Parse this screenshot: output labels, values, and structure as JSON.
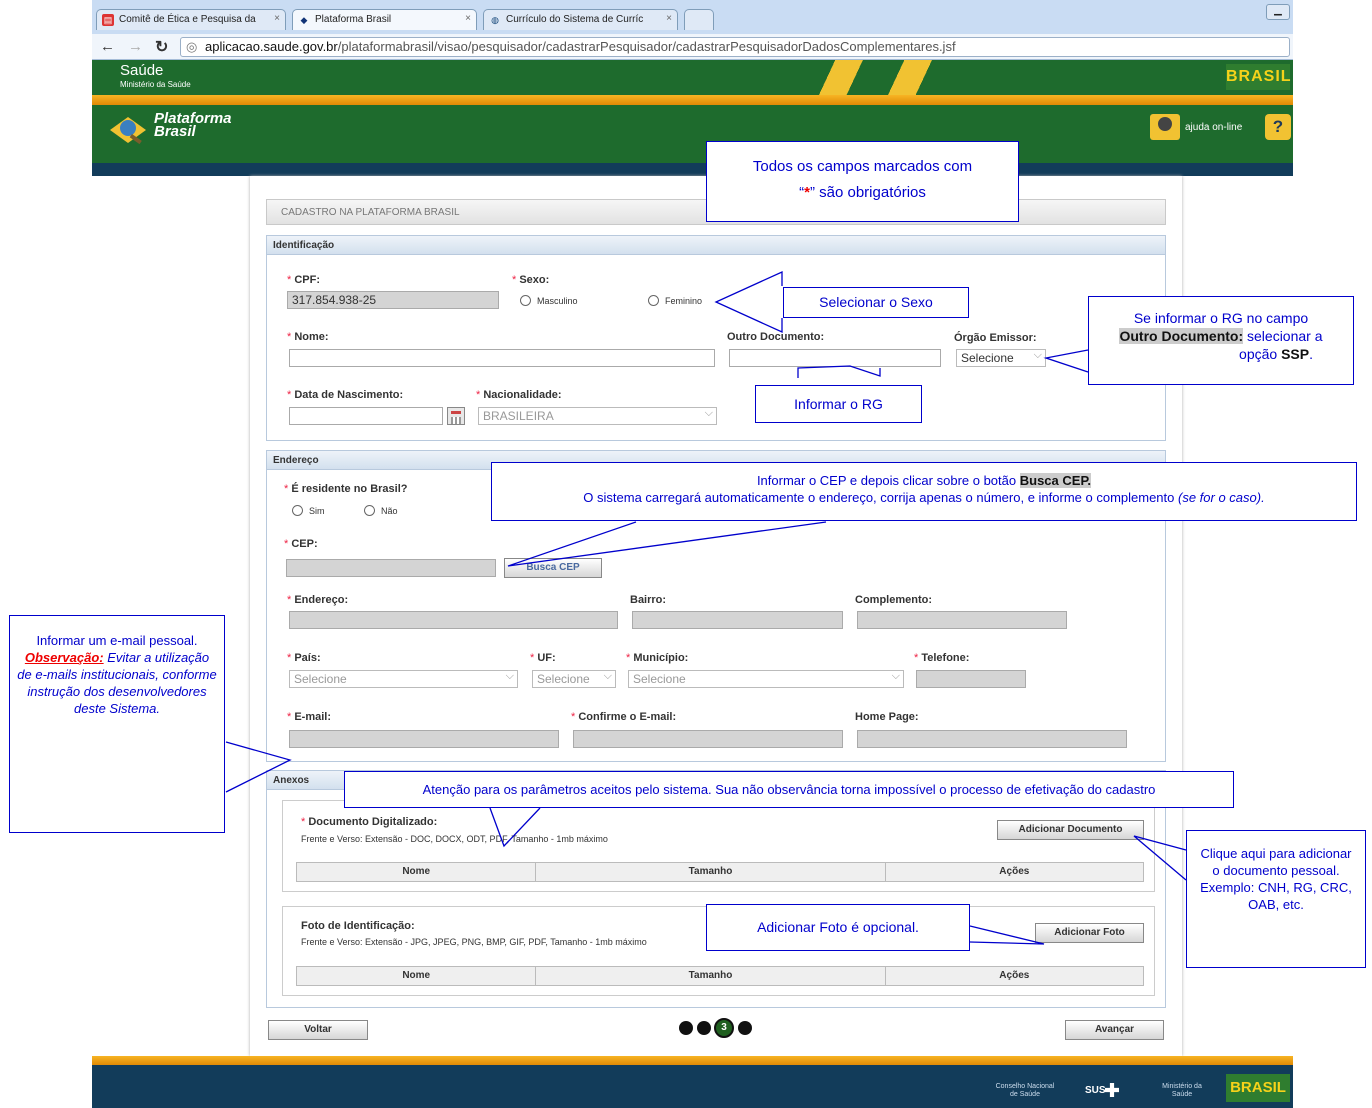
{
  "browser": {
    "tabs": [
      "Comitê de Ética e Pesquisa da",
      "Plataforma Brasil",
      "Currículo do Sistema de Curríc"
    ],
    "url_domain": "aplicacao.saude.gov.br",
    "url_path": "/plataformabrasil/visao/pesquisador/cadastrarPesquisador/cadastrarPesquisadorDadosComplementares.jsf"
  },
  "gov": {
    "title": "Saúde",
    "subtitle": "Ministério da Saúde",
    "brasil": "BRASIL"
  },
  "banner": {
    "logo_line1": "Plataforma",
    "logo_line2": "Brasil",
    "help": "ajuda on-line",
    "help_icon": "?"
  },
  "page": {
    "title": "CADASTRO NA PLATAFORMA BRASIL"
  },
  "ident": {
    "heading": "Identificação",
    "cpf_label": "CPF:",
    "cpf_value": "317.854.938-25",
    "sexo_label": "Sexo:",
    "masc": "Masculino",
    "fem": "Feminino",
    "nome_label": "Nome:",
    "outro_label": "Outro Documento:",
    "orgao_label": "Órgão Emissor:",
    "orgao_value": "Selecione",
    "nasc_label": "Data de Nascimento:",
    "nac_label": "Nacionalidade:",
    "nac_value": "BRASILEIRA"
  },
  "endereco": {
    "heading": "Endereço",
    "residente_label": "É residente no Brasil?",
    "sim": "Sim",
    "nao": "Não",
    "cep_label": "CEP:",
    "busca_cep": "Busca CEP",
    "endereco_label": "Endereço:",
    "bairro_label": "Bairro:",
    "complemento_label": "Complemento:",
    "pais_label": "País:",
    "pais_value": "Selecione",
    "uf_label": "UF:",
    "uf_value": "Selecione",
    "municipio_label": "Município:",
    "municipio_value": "Selecione",
    "telefone_label": "Telefone:",
    "email_label": "E-mail:",
    "confirma_label": "Confirme o E-mail:",
    "homepage_label": "Home Page:"
  },
  "anexos": {
    "heading": "Anexos",
    "doc_title": "Documento Digitalizado:",
    "doc_desc": "Frente e Verso: Extensão - DOC, DOCX, ODT, PDF, Tamanho - 1mb máximo",
    "add_doc": "Adicionar Documento",
    "foto_title": "Foto de Identificação:",
    "foto_desc": "Frente e Verso: Extensão - JPG, JPEG, PNG, BMP, GIF, PDF, Tamanho - 1mb máximo",
    "add_foto": "Adicionar Foto",
    "col_nome": "Nome",
    "col_tamanho": "Tamanho",
    "col_acoes": "Ações"
  },
  "nav": {
    "voltar": "Voltar",
    "avancar": "Avançar",
    "step": "3"
  },
  "footer": {
    "conselho": "Conselho Nacional de Saúde",
    "sus": "SUS",
    "ministerio": "Ministério da Saúde",
    "brasil": "BRASIL"
  },
  "callouts": {
    "obrig_1": "Todos os campos marcados com",
    "obrig_quote_open": "“",
    "obrig_star": "*",
    "obrig_quote_close": "”",
    "obrig_2": "são obrigatórios",
    "sexo": "Selecionar o Sexo",
    "rg": "Informar o RG",
    "ssp_1": "Se informar o RG no campo",
    "ssp_b": "Outro Documento:",
    "ssp_2": "selecionar a",
    "ssp_3": "opção",
    "ssp_b2": "SSP",
    "ssp_dot": ".",
    "cep_1": "Informar o CEP e depois clicar sobre o botão",
    "cep_b": "Busca CEP.",
    "cep_2": "O sistema carregará automaticamente o endereço, corrija apenas o número, e informe o complemento",
    "cep_i": "(se for o caso).",
    "email_1": "Informar um e-mail pessoal.",
    "email_obs": "Observação:",
    "email_2": "Evitar a utilização de e-mails institucionais, conforme instrução dos desenvolvedores deste Sistema.",
    "atencao": "Atenção para os parâmetros aceitos pelo sistema. Sua não observância torna impossível o processo de efetivação do cadastro",
    "doc": "Clique aqui para adicionar o documento pessoal. Exemplo: CNH, RG, CRC, OAB, etc.",
    "foto": "Adicionar Foto é opcional."
  },
  "colors": {
    "gov_green": "#1e6b2d",
    "navy": "#123c5a",
    "orange": "#f7b423",
    "callout_blue": "#0000cc",
    "required_red": "#e22244"
  }
}
